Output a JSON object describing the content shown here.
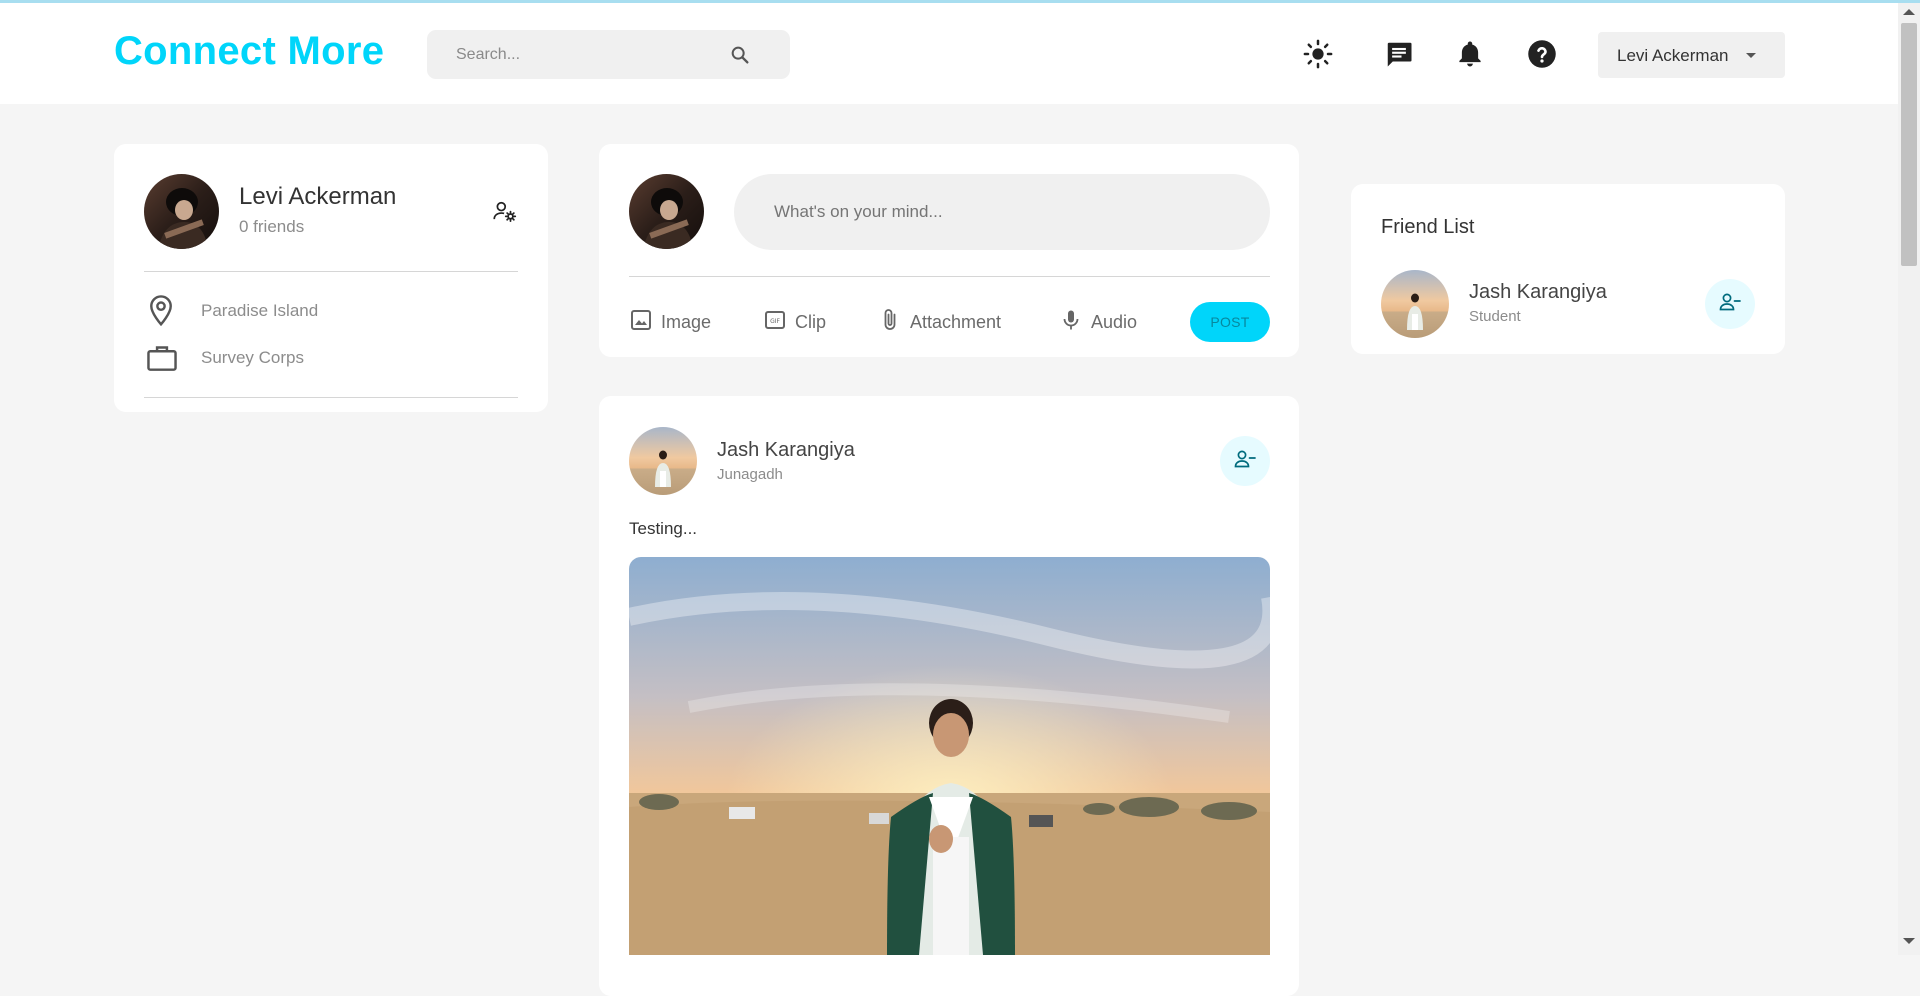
{
  "navbar": {
    "logo": "Connect More",
    "search_placeholder": "Search...",
    "user_select_label": "Levi Ackerman",
    "icons": [
      "light-mode-icon",
      "message-icon",
      "notification-bell-icon",
      "help-icon"
    ]
  },
  "profile_card": {
    "name": "Levi Ackerman",
    "friends": "0 friends",
    "location": "Paradise Island",
    "occupation": "Survey Corps"
  },
  "composer": {
    "placeholder": "What's on your mind...",
    "actions": [
      "Image",
      "Clip",
      "Attachment",
      "Audio"
    ],
    "post_label": "POST"
  },
  "post": {
    "author": "Jash Karangiya",
    "location": "Junagadh",
    "text": "Testing..."
  },
  "friend_list": {
    "title": "Friend List",
    "friends": [
      {
        "name": "Jash Karangiya",
        "subtitle": "Student"
      }
    ]
  },
  "colors": {
    "brand": "#00d5fa",
    "background": "#f5f5f5",
    "card": "#ffffff",
    "muted_text": "#8c8c8c",
    "friend_button_bg": "#e6fbff",
    "friend_button_icon": "#006b7d"
  }
}
